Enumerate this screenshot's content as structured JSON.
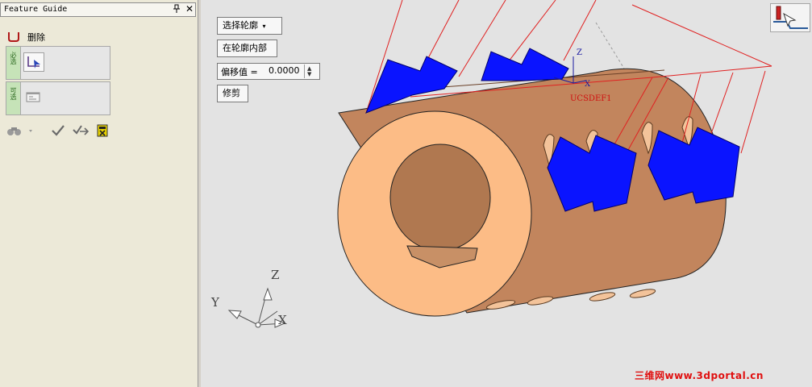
{
  "panel": {
    "title": "Feature Guide",
    "pin_glyph": "ᵖ",
    "close_glyph": "✕",
    "delete_label": "删除",
    "steps": [
      {
        "tab_label": "必选",
        "icon": "select-contour-icon"
      },
      {
        "tab_label": "可选",
        "icon": "options-icon"
      }
    ],
    "tools": [
      "binoculars-icon",
      "check-icon",
      "apply-check-icon",
      "calculator-icon"
    ]
  },
  "viewport": {
    "select_contour_label": "选择轮廓",
    "inside_contour_label": "在轮廓内部",
    "offset_label": "偏移值 =",
    "offset_value": "0.0000",
    "trim_label": "修剪",
    "ucs_label": "UCSDEF1",
    "axis_labels": {
      "z": "Z",
      "y": "Y",
      "x": "X"
    },
    "corner_icon": "machining-tool-icon"
  },
  "watermark": "三维网www.3dportal.cn",
  "colors": {
    "part_face": "#fcbc86",
    "part_body": "#c2855d",
    "tool": "#0a14ff",
    "wire": "#e02020"
  }
}
